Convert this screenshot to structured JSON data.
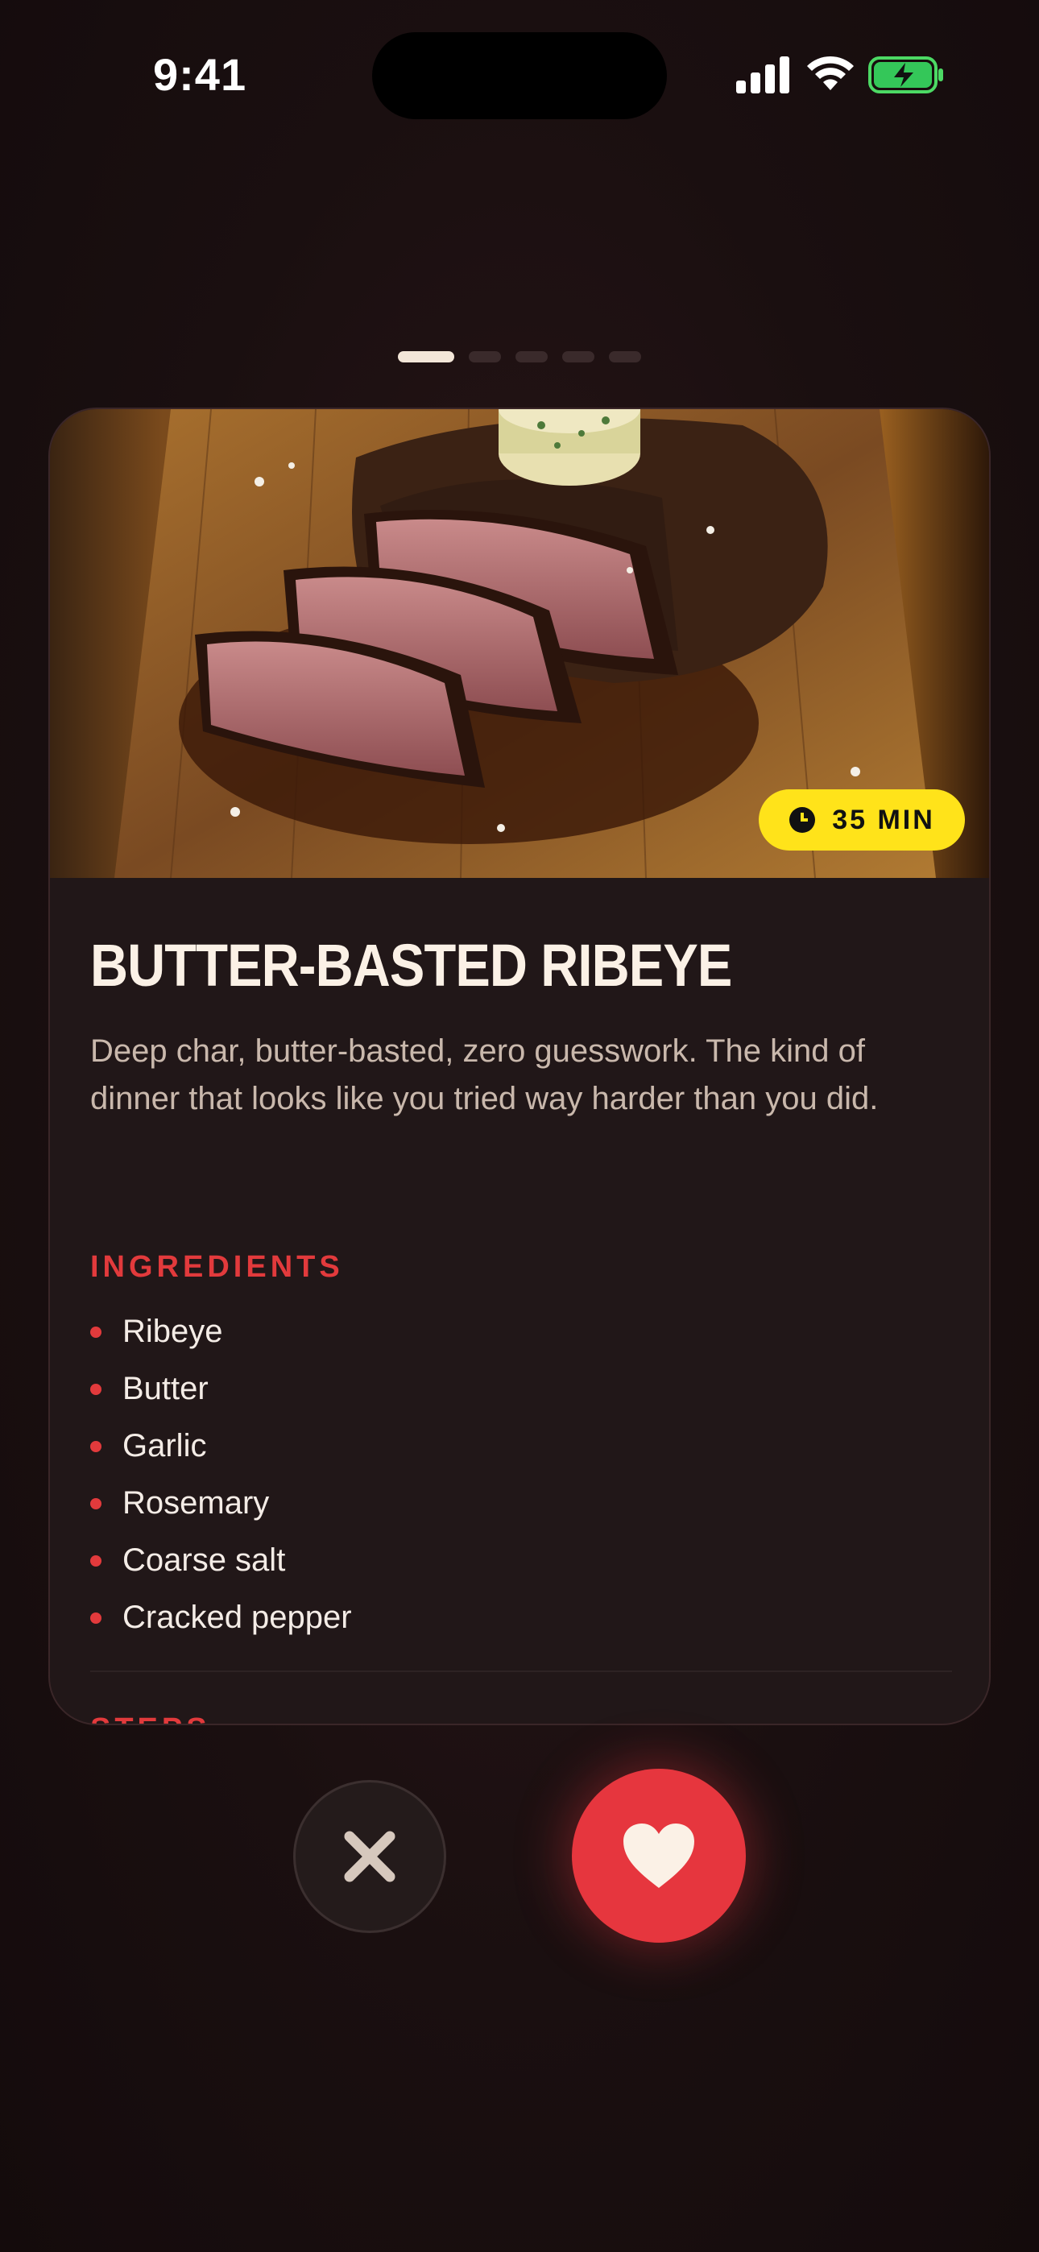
{
  "status_bar": {
    "time": "9:41"
  },
  "pager": {
    "count": 5,
    "active_index": 0
  },
  "recipe": {
    "cook_time": "35 MIN",
    "title": "BUTTER-BASTED RIBEYE",
    "description": "Deep char, butter-basted, zero guesswork. The kind of dinner that looks like you tried way harder than you did.",
    "ingredients_heading": "INGREDIENTS",
    "ingredients": [
      "Ribeye",
      "Butter",
      "Garlic",
      "Rosemary",
      "Coarse salt",
      "Cracked pepper"
    ],
    "steps_heading": "STEPS"
  },
  "actions": {
    "dismiss_icon": "close-icon",
    "like_icon": "heart-icon"
  },
  "colors": {
    "accent_red": "#e6363e",
    "badge_yellow": "#ffe31a",
    "card_bg": "#211718"
  }
}
